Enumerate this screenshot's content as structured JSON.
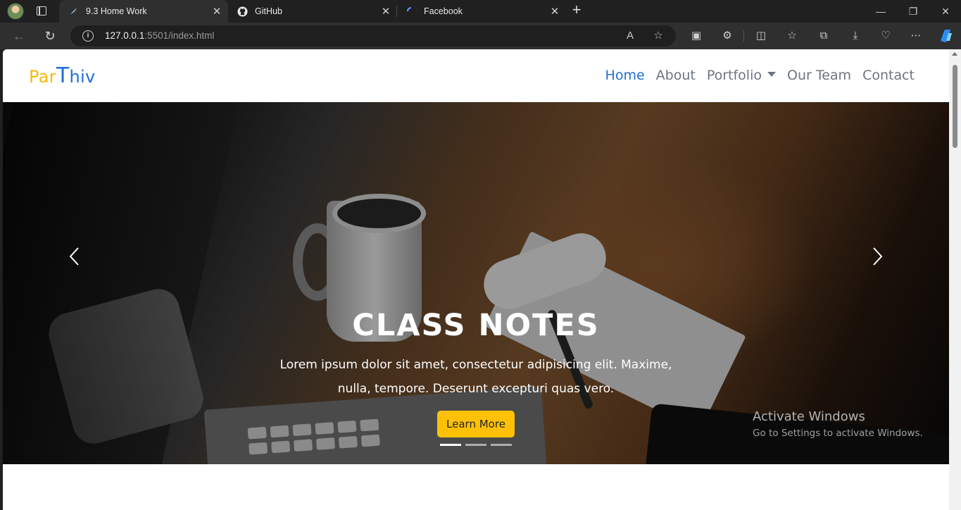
{
  "browser": {
    "tabs": [
      {
        "title": "9.3 Home Work",
        "active": true,
        "favicon": "feather-icon"
      },
      {
        "title": "GitHub",
        "active": false,
        "favicon": "github-icon"
      },
      {
        "title": "Facebook",
        "active": false,
        "favicon": "loading-spinner-icon"
      }
    ],
    "address": {
      "host": "127.0.0.1",
      "path": ":5501/index.html"
    }
  },
  "site": {
    "brand": {
      "part1": "Par",
      "part2": "T",
      "part3": "hiv"
    },
    "nav": [
      {
        "label": "Home",
        "active": true
      },
      {
        "label": "About",
        "active": false
      },
      {
        "label": "Portfolio",
        "active": false,
        "dropdown": true
      },
      {
        "label": "Our Team",
        "active": false
      },
      {
        "label": "Contact",
        "active": false
      }
    ],
    "carousel": {
      "title": "CLASS NOTES",
      "text": "Lorem ipsum dolor sit amet, consectetur adipisicing elit. Maxime, nulla, tempore. Deserunt excepturi quas vero.",
      "button": "Learn More",
      "indicators": 3,
      "active_index": 0
    }
  },
  "os_watermark": {
    "line1": "Activate Windows",
    "line2": "Go to Settings to activate Windows."
  },
  "colors": {
    "brand_yellow": "#f6b80b",
    "brand_blue": "#1e6fd6",
    "button": "#ffc107",
    "nav_text": "#6c757d"
  }
}
